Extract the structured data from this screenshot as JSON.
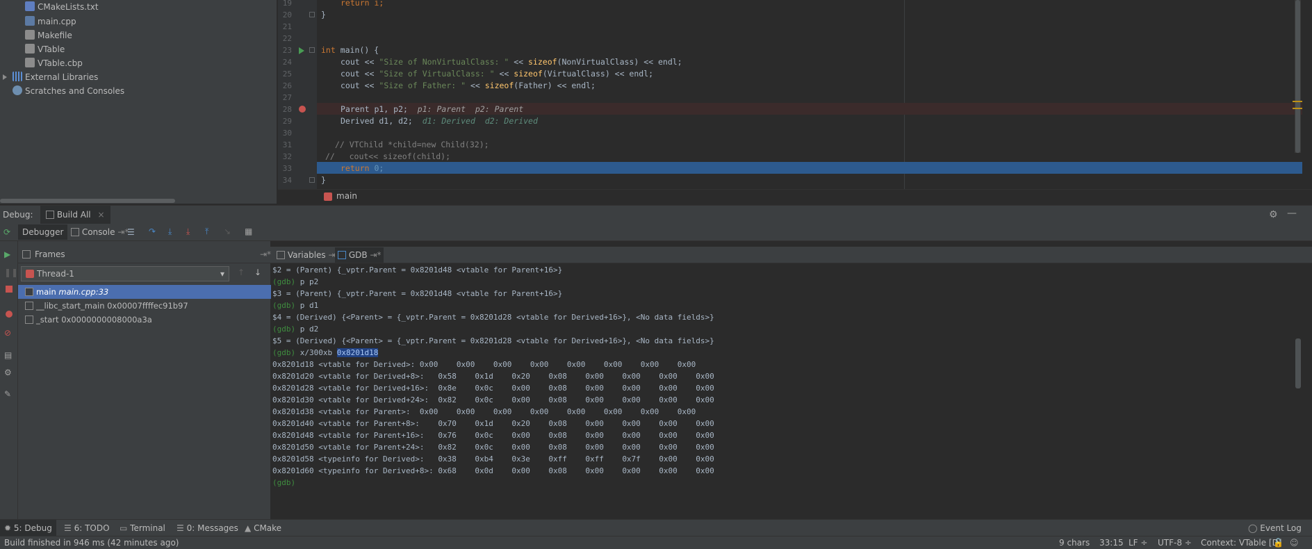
{
  "project_tree": {
    "items": [
      {
        "label": "CMakeLists.txt",
        "icon": "cmake-file-icon"
      },
      {
        "label": "main.cpp",
        "icon": "cpp-file-icon"
      },
      {
        "label": "Makefile",
        "icon": "makefile-icon"
      },
      {
        "label": "VTable",
        "icon": "file-icon"
      },
      {
        "label": "VTable.cbp",
        "icon": "file-icon"
      },
      {
        "label": "External Libraries",
        "icon": "library-icon"
      },
      {
        "label": "Scratches and Consoles",
        "icon": "scratches-icon"
      }
    ]
  },
  "editor": {
    "line_numbers": [
      "19",
      "20",
      "21",
      "22",
      "23",
      "24",
      "25",
      "26",
      "27",
      "28",
      "29",
      "30",
      "31",
      "32",
      "33",
      "34"
    ],
    "line19_code": "return i;",
    "line20_code": "}",
    "line23_kw": "int",
    "line23_rest": " main() {",
    "line24": {
      "a": "cout << ",
      "s": "\"Size of NonVirtualClass: \"",
      "b": " << ",
      "f": "sizeof",
      "c": "(NonVirtualClass) << endl;"
    },
    "line25": {
      "a": "cout << ",
      "s": "\"Size of VirtualClass: \"",
      "b": " << ",
      "f": "sizeof",
      "c": "(VirtualClass) << endl;"
    },
    "line26": {
      "a": "cout << ",
      "s": "\"Size of Father: \"",
      "b": " << ",
      "f": "sizeof",
      "c": "(Father) << endl;"
    },
    "line28_code": "Parent p1, p2;",
    "line28_inline": "p1: Parent  p2: Parent",
    "line29_code": "Derived d1, d2;",
    "line29_inline": "d1: Derived  d2: Derived",
    "line31_code": "// VTChild *child=new Child(32);",
    "line32_code": "//   cout<< sizeof(child);",
    "line33_kw": "return",
    "line33_num": " 0;",
    "line34_code": "}",
    "breadcrumb": "main"
  },
  "debug": {
    "title_label": "Debug:",
    "config_tab": "Build All",
    "tabs": {
      "debugger": "Debugger",
      "console": "Console"
    },
    "frames_title": "Frames",
    "thread": "Thread-1",
    "frames": [
      {
        "name": "main",
        "loc": "main.cpp:33"
      },
      {
        "name": "__libc_start_main 0x00007ffffec91b97",
        "loc": ""
      },
      {
        "name": "_start 0x0000000008000a3a",
        "loc": ""
      }
    ],
    "variables_tab": "Variables",
    "gdb_tab": "GDB",
    "gdb_lines": [
      "$2 = (Parent) {_vptr.Parent = 0x8201d48 <vtable for Parent+16>}",
      "(gdb) |p p2",
      "$3 = (Parent) {_vptr.Parent = 0x8201d48 <vtable for Parent+16>}",
      "(gdb) |p d1",
      "$4 = (Derived) {<Parent> = {_vptr.Parent = 0x8201d28 <vtable for Derived+16>}, <No data fields>}",
      "(gdb) |p d2",
      "$5 = (Derived) {<Parent> = {_vptr.Parent = 0x8201d28 <vtable for Derived+16>}, <No data fields>}",
      "(gdb) |x/300xb ",
      "0x8201d18 <vtable for Derived>: 0x00    0x00    0x00    0x00    0x00    0x00    0x00    0x00",
      "0x8201d20 <vtable for Derived+8>:   0x58    0x1d    0x20    0x08    0x00    0x00    0x00    0x00",
      "0x8201d28 <vtable for Derived+16>:  0x8e    0x0c    0x00    0x08    0x00    0x00    0x00    0x00",
      "0x8201d30 <vtable for Derived+24>:  0x82    0x0c    0x00    0x08    0x00    0x00    0x00    0x00",
      "0x8201d38 <vtable for Parent>:  0x00    0x00    0x00    0x00    0x00    0x00    0x00    0x00",
      "0x8201d40 <vtable for Parent+8>:    0x70    0x1d    0x20    0x08    0x00    0x00    0x00    0x00",
      "0x8201d48 <vtable for Parent+16>:   0x76    0x0c    0x00    0x08    0x00    0x00    0x00    0x00",
      "0x8201d50 <vtable for Parent+24>:   0x82    0x0c    0x00    0x08    0x00    0x00    0x00    0x00",
      "0x8201d58 <typeinfo for Derived>:   0x38    0xb4    0x3e    0xff    0xff    0x7f    0x00    0x00",
      "0x8201d60 <typeinfo for Derived+8>: 0x68    0x0d    0x00    0x08    0x00    0x00    0x00    0x00",
      "(gdb) |"
    ],
    "gdb_selected": "0x8201d18"
  },
  "tool_tabs": [
    {
      "label": "5: Debug",
      "icon": "bug-icon"
    },
    {
      "label": "6: TODO",
      "icon": "todo-icon"
    },
    {
      "label": "Terminal",
      "icon": "terminal-icon"
    },
    {
      "label": "0: Messages",
      "icon": "messages-icon"
    },
    {
      "label": "CMake",
      "icon": "cmake-icon"
    }
  ],
  "event_log": "Event Log",
  "status": {
    "message": "Build finished in 946 ms (42 minutes ago)",
    "chars": "9 chars",
    "position": "33:15",
    "line_sep": "LF ÷",
    "encoding": "UTF-8 ÷",
    "context": "Context: VTable [D]"
  },
  "colors": {
    "accent": "#4b6eaf",
    "current_line": "#2d5a8e",
    "breakpoint": "#c75450",
    "prompt": "#3f8c3f"
  }
}
